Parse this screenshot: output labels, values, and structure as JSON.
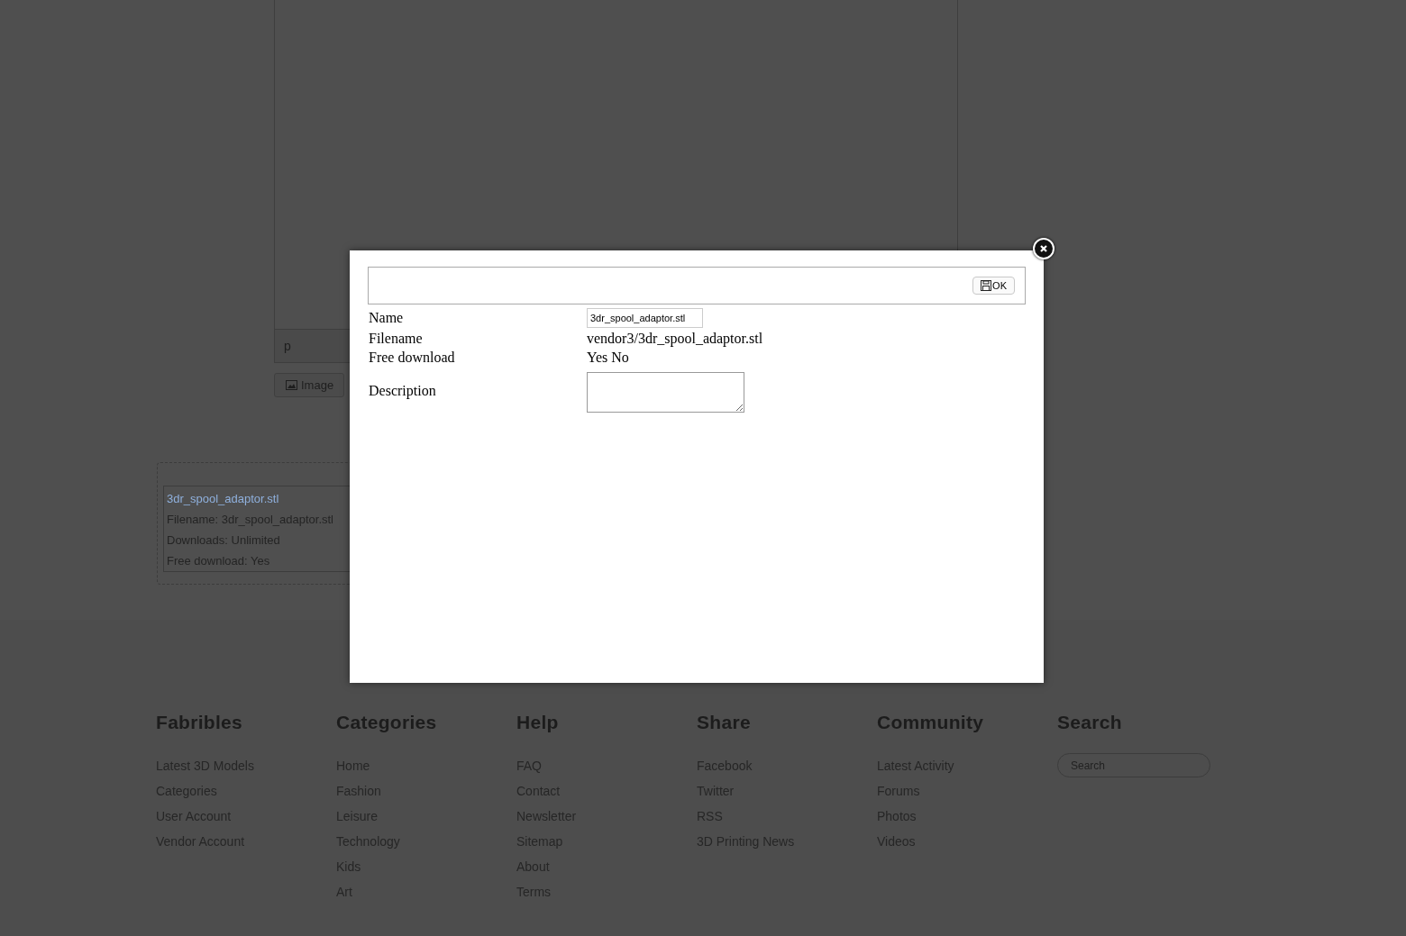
{
  "editor": {
    "status_text": "p",
    "image_button": "Image"
  },
  "file_card": {
    "title": "3dr_spool_adaptor.stl",
    "lines": [
      "Filename: 3dr_spool_adaptor.stl",
      "Downloads: Unlimited",
      "Free download: Yes"
    ]
  },
  "dialog": {
    "ok_button": "OK",
    "fields": [
      {
        "label": "Name",
        "kind": "input",
        "value": "3dr_spool_adaptor.stl"
      },
      {
        "label": "Filename",
        "kind": "text",
        "value": "vendor3/3dr_spool_adaptor.stl"
      },
      {
        "label": "Free download",
        "kind": "text",
        "value": "Yes No"
      },
      {
        "label": "Description",
        "kind": "textarea"
      }
    ]
  },
  "footer": {
    "columns": [
      {
        "heading": "Fabribles",
        "links": [
          "Latest 3D Models",
          "Categories",
          "User Account",
          "Vendor Account"
        ]
      },
      {
        "heading": "Categories",
        "links": [
          "Home",
          "Fashion",
          "Leisure",
          "Technology",
          "Kids",
          "Art"
        ]
      },
      {
        "heading": "Help",
        "links": [
          "FAQ",
          "Contact",
          "Newsletter",
          "Sitemap",
          "About",
          "Terms"
        ]
      },
      {
        "heading": "Share",
        "links": [
          "Facebook",
          "Twitter",
          "RSS",
          "3D Printing News"
        ]
      },
      {
        "heading": "Community",
        "links": [
          "Latest Activity",
          "Forums",
          "Photos",
          "Videos"
        ]
      }
    ],
    "search": {
      "heading": "Search",
      "placeholder": "Search"
    }
  }
}
